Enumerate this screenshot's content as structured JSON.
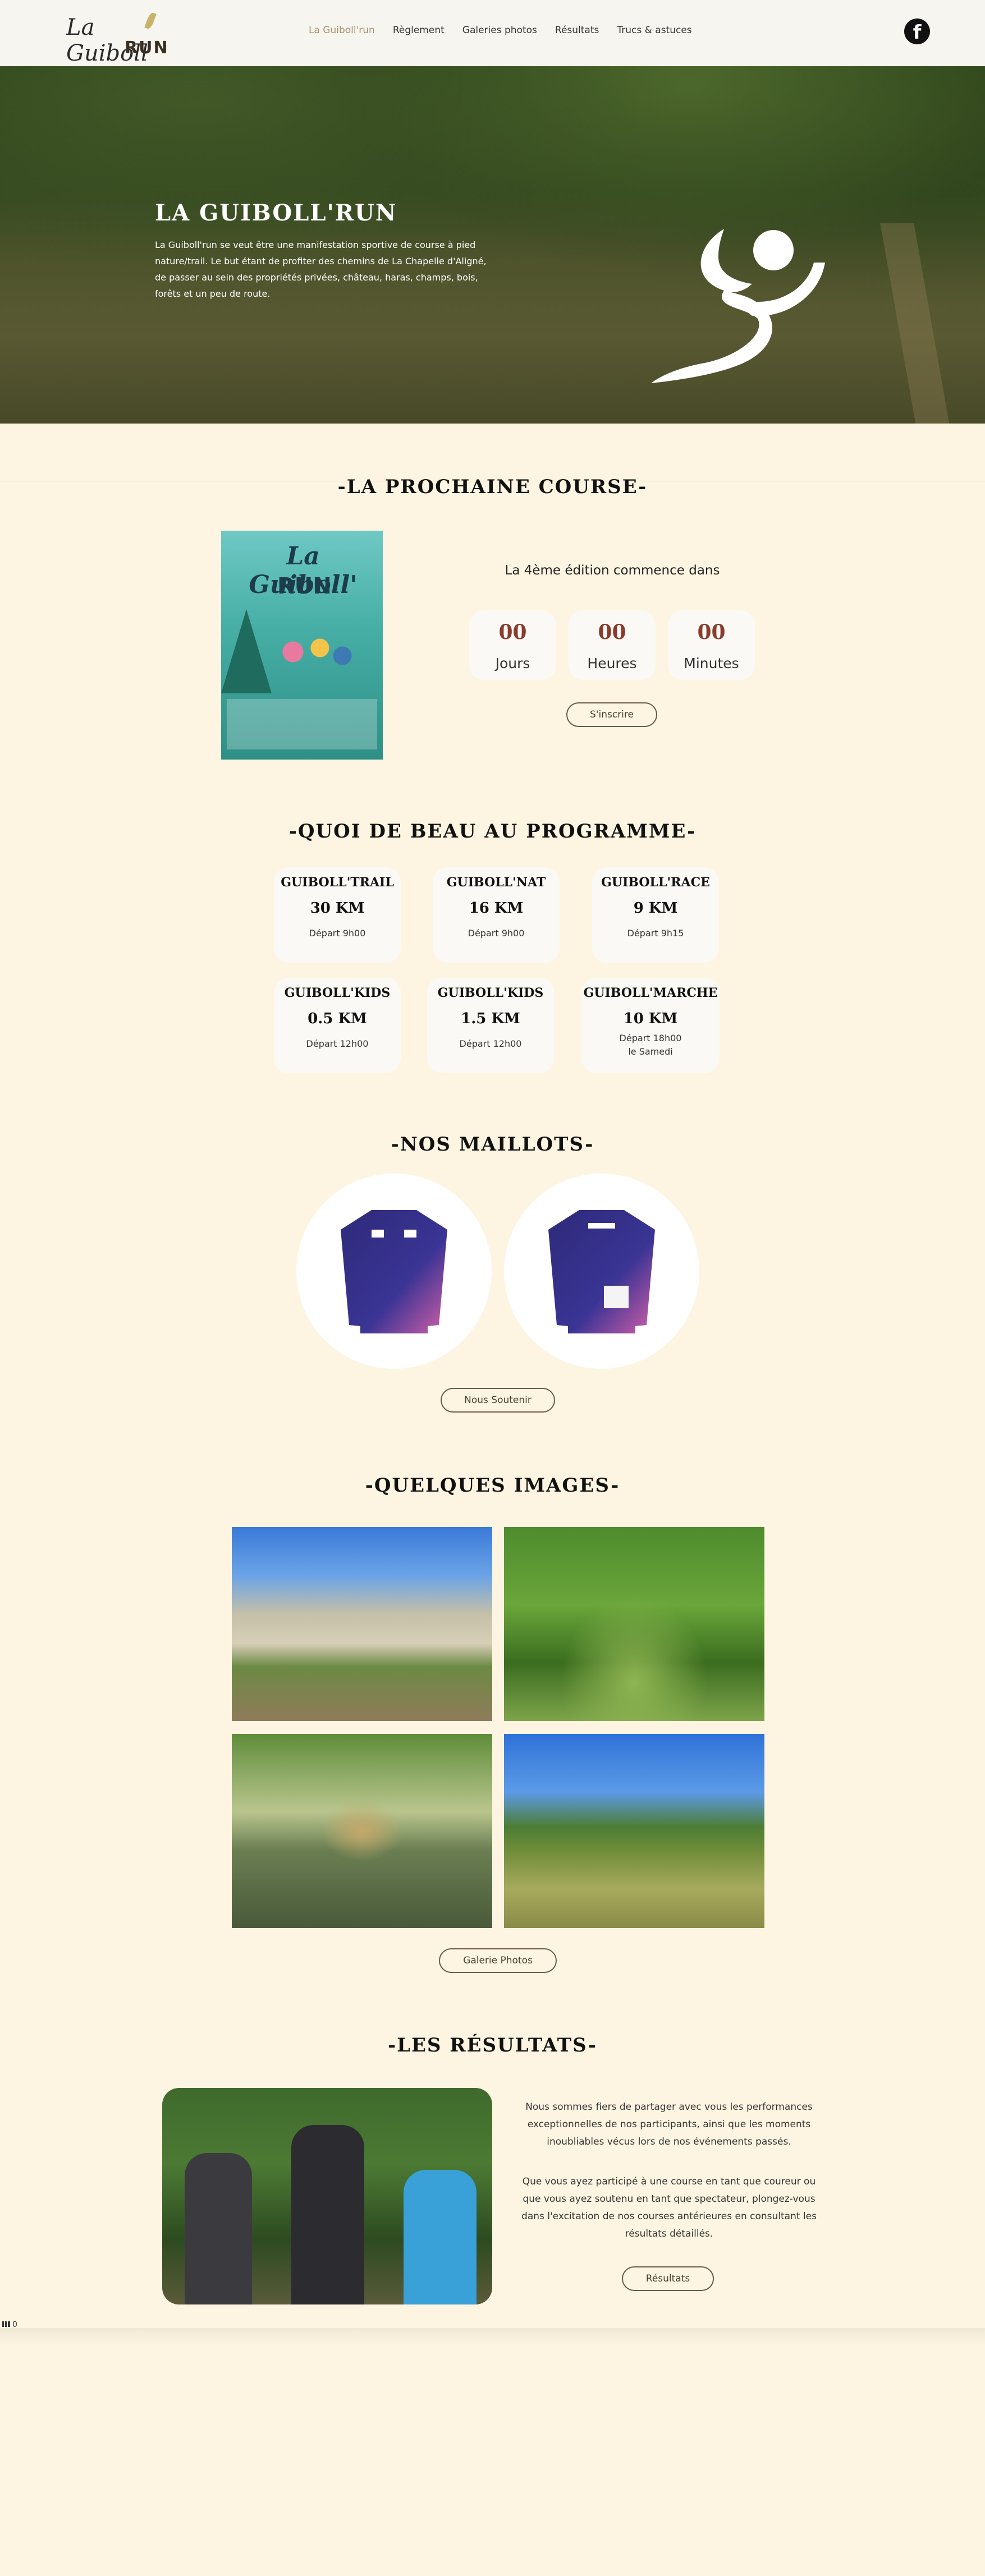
{
  "header": {
    "logo_la": "La Guiboll",
    "logo_run": "RUN",
    "nav": [
      "La Guiboll'run",
      "Règlement",
      "Galeries photos",
      "Résultats",
      "Trucs & astuces"
    ],
    "facebook_glyph": "f"
  },
  "hero": {
    "title": "LA GUIBOLL'RUN",
    "text": "La Guiboll'run se veut être une manifestation sportive de course à pied nature/trail. Le but étant de profiter des chemins de La Chapelle d'Aligné, de passer au sein des propriétés privées, château, haras, champs, bois, forêts et un peu de route."
  },
  "next_race": {
    "title": "-LA PROCHAINE COURSE-",
    "poster_title": "La Guiboll'",
    "poster_run": "RUN",
    "caption": "La 4ème édition commence dans",
    "countdown": [
      {
        "value": "00",
        "label": "Jours"
      },
      {
        "value": "00",
        "label": "Heures"
      },
      {
        "value": "00",
        "label": "Minutes"
      }
    ],
    "button": "S'inscrire"
  },
  "programme": {
    "title": "-QUOI DE BEAU AU PROGRAMME-",
    "races": [
      {
        "name": "GUIBOLL'TRAIL",
        "distance": "30 KM",
        "time": "Départ 9h00"
      },
      {
        "name": "GUIBOLL'NAT",
        "distance": "16 KM",
        "time": "Départ 9h00"
      },
      {
        "name": "GUIBOLL'RACE",
        "distance": "9 KM",
        "time": "Départ 9h15"
      },
      {
        "name": "GUIBOLL'KIDS",
        "distance": "0.5 KM",
        "time": "Départ 12h00"
      },
      {
        "name": "GUIBOLL'KIDS",
        "distance": "1.5 KM",
        "time": "Départ 12h00"
      },
      {
        "name": "GUIBOLL'MARCHE",
        "distance": "10 KM",
        "time": "Départ 18h00\nle Samedi"
      }
    ]
  },
  "jerseys": {
    "title": "-NOS MAILLOTS-",
    "button": "Nous Soutenir"
  },
  "gallery": {
    "title": "-QUELQUES IMAGES-",
    "button": "Galerie Photos"
  },
  "results": {
    "title": "-LES RÉSULTATS-",
    "paragraph1": "Nous sommes fiers de partager avec vous les performances exceptionnelles de nos participants, ainsi que les moments inoubliables vécus lors de nos événements passés.",
    "paragraph2": "Que vous ayez participé à une course en tant que coureur ou que vous ayez soutenu en tant que spectateur, plongez-vous dans l'excitation de nos courses antérieures en consultant les résultats détaillés.",
    "button": "Résultats"
  },
  "stats": {
    "count": "0"
  },
  "colors": {
    "background": "#fdf5e1",
    "accent": "#a5926a",
    "countdown_number": "#8a3c2c"
  }
}
